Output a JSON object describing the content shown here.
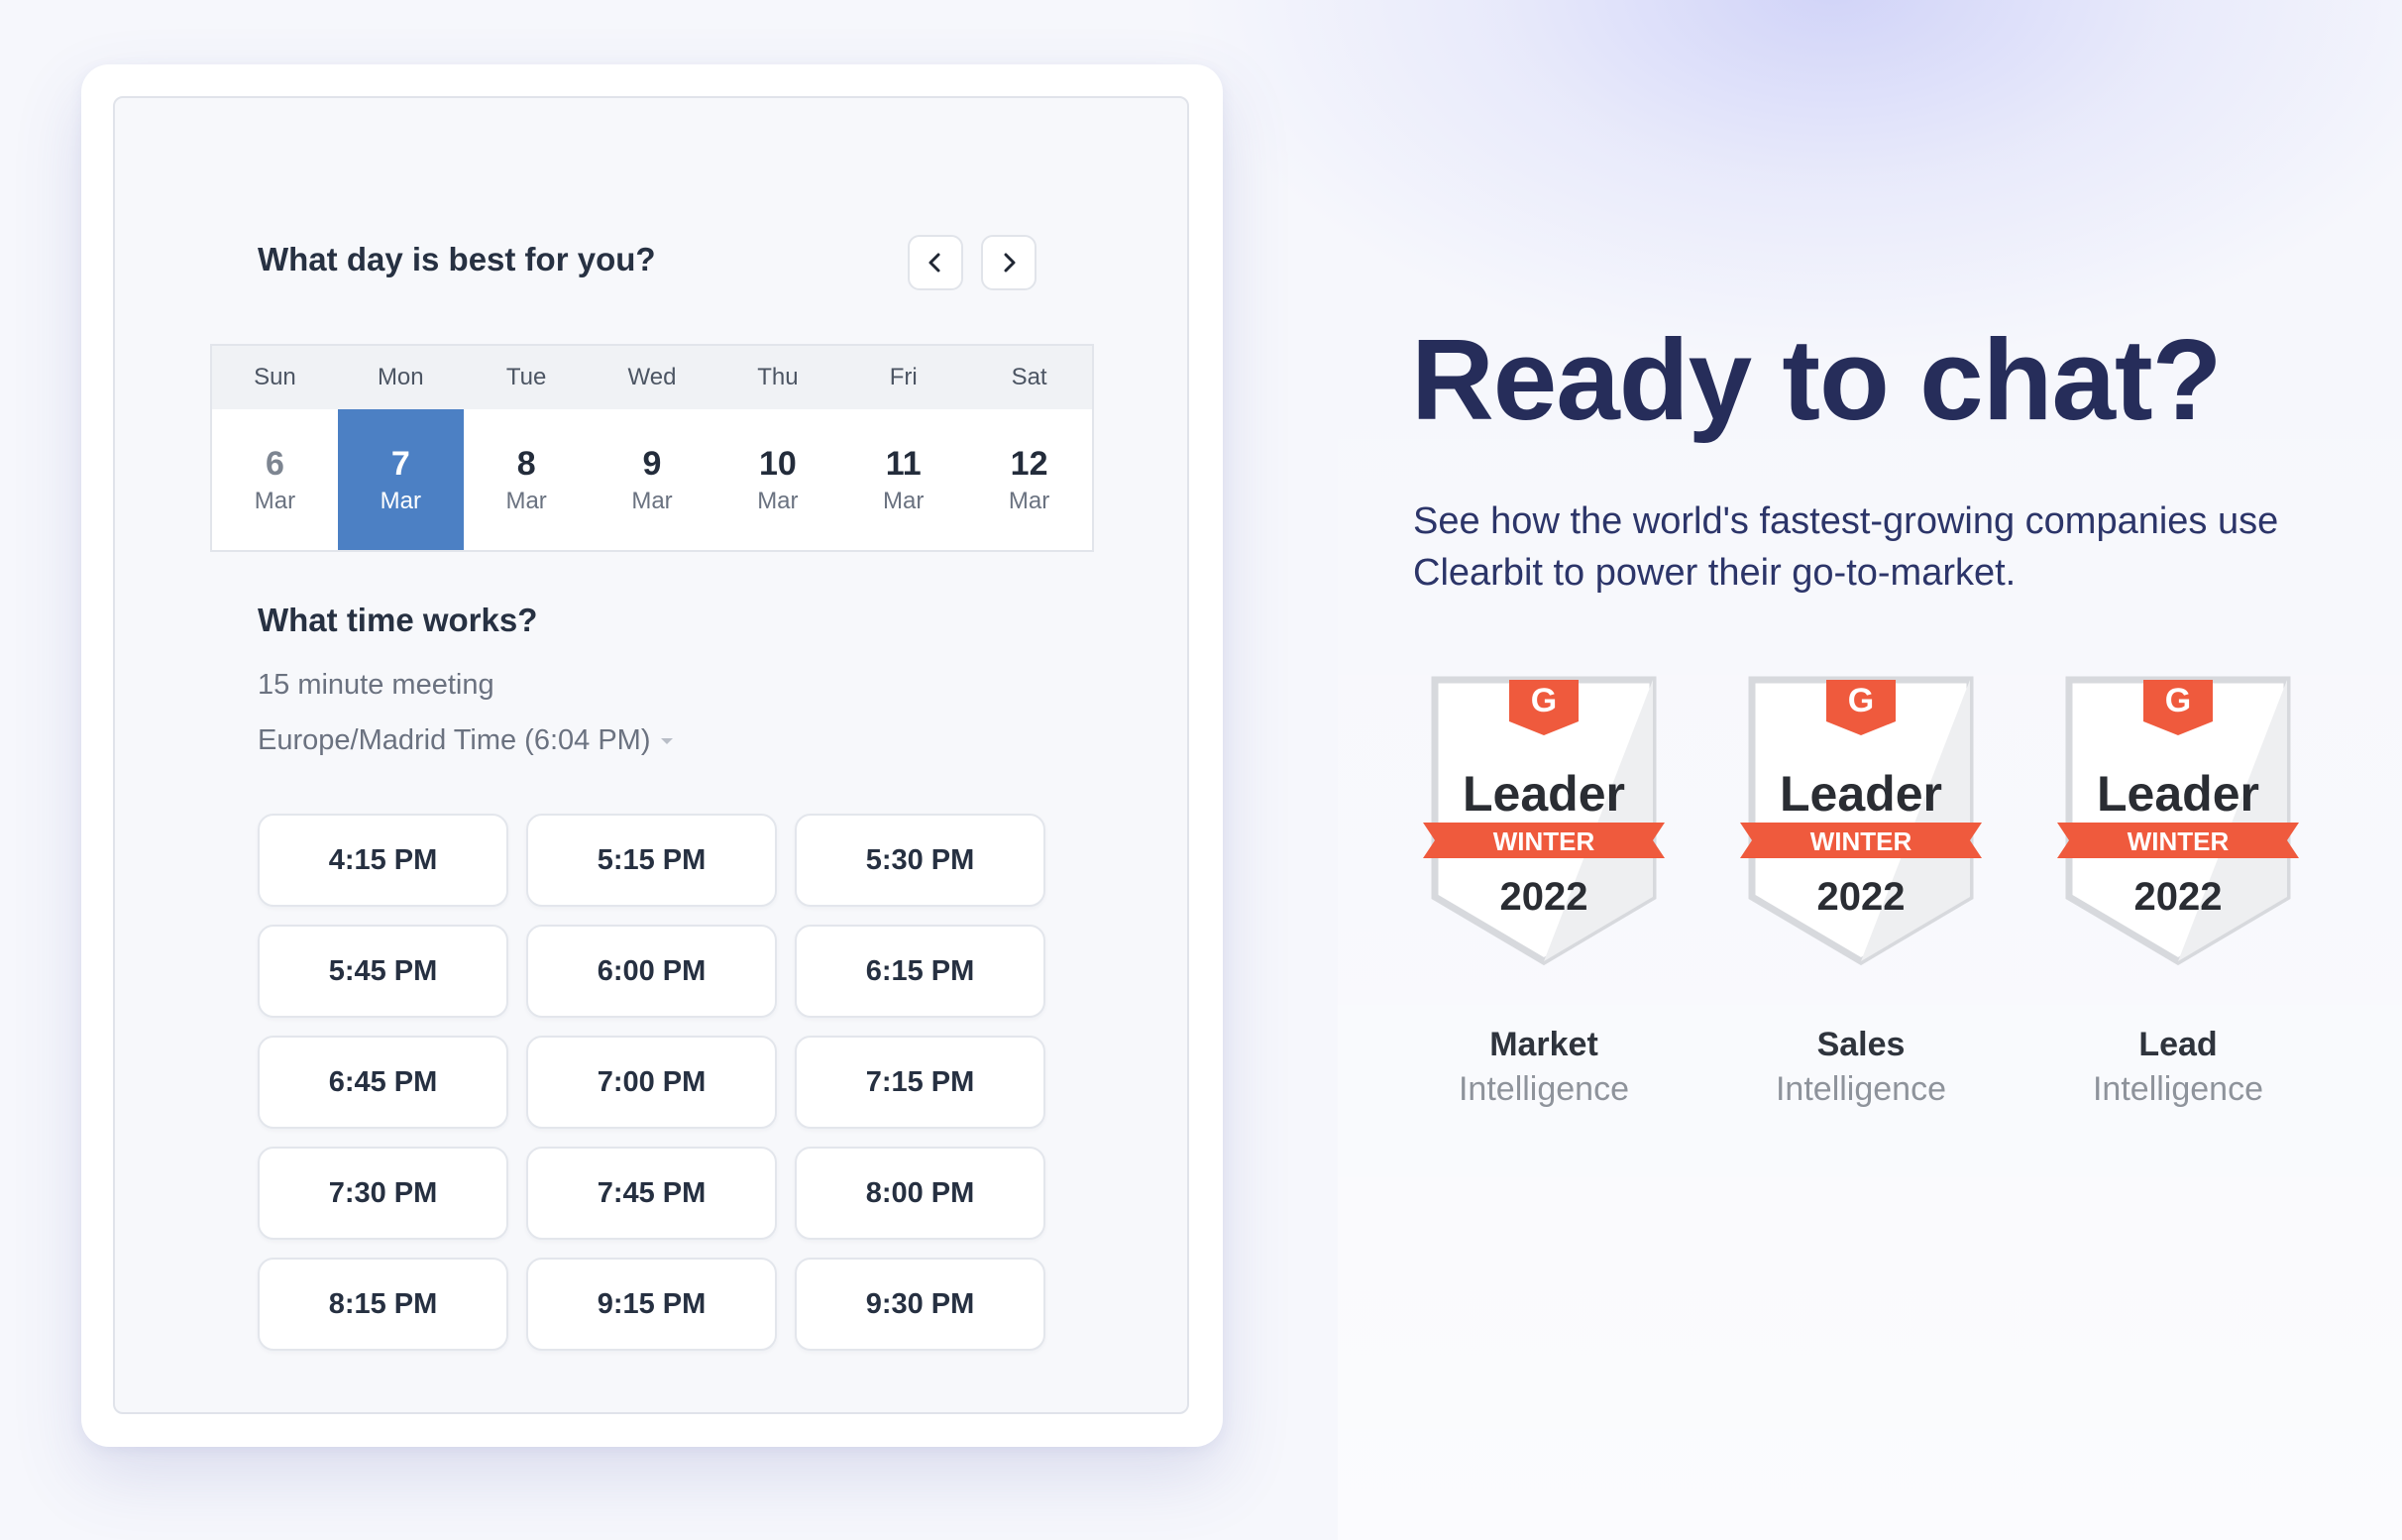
{
  "scheduler": {
    "day_question": "What day is best for you?",
    "time_question": "What time works?",
    "meeting_length": "15 minute meeting",
    "timezone": "Europe/Madrid Time (6:04 PM)",
    "nav": {
      "prev_icon": "chevron-left-icon",
      "next_icon": "chevron-right-icon"
    },
    "weekdays": [
      "Sun",
      "Mon",
      "Tue",
      "Wed",
      "Thu",
      "Fri",
      "Sat"
    ],
    "days": [
      {
        "day": "6",
        "month": "Mar",
        "state": "past"
      },
      {
        "day": "7",
        "month": "Mar",
        "state": "selected"
      },
      {
        "day": "8",
        "month": "Mar",
        "state": "available"
      },
      {
        "day": "9",
        "month": "Mar",
        "state": "available"
      },
      {
        "day": "10",
        "month": "Mar",
        "state": "available"
      },
      {
        "day": "11",
        "month": "Mar",
        "state": "available"
      },
      {
        "day": "12",
        "month": "Mar",
        "state": "available"
      }
    ],
    "slots": [
      "4:15 PM",
      "5:15 PM",
      "5:30 PM",
      "5:45 PM",
      "6:00 PM",
      "6:15 PM",
      "6:45 PM",
      "7:00 PM",
      "7:15 PM",
      "7:30 PM",
      "7:45 PM",
      "8:00 PM",
      "8:15 PM",
      "9:15 PM",
      "9:30 PM"
    ]
  },
  "hero": {
    "title": "Ready to chat?",
    "subtitle": "See how the world's fastest-growing companies use Clearbit to power their go-to-market."
  },
  "badges": [
    {
      "top": "Leader",
      "ribbon": "WINTER",
      "year": "2022",
      "category": "Market",
      "subcategory": "Intelligence"
    },
    {
      "top": "Leader",
      "ribbon": "WINTER",
      "year": "2022",
      "category": "Sales",
      "subcategory": "Intelligence"
    },
    {
      "top": "Leader",
      "ribbon": "WINTER",
      "year": "2022",
      "category": "Lead",
      "subcategory": "Intelligence"
    }
  ],
  "colors": {
    "selected_day": "#4c80c4",
    "hero_text": "#262d5a",
    "g2_red": "#ef5a3d"
  }
}
